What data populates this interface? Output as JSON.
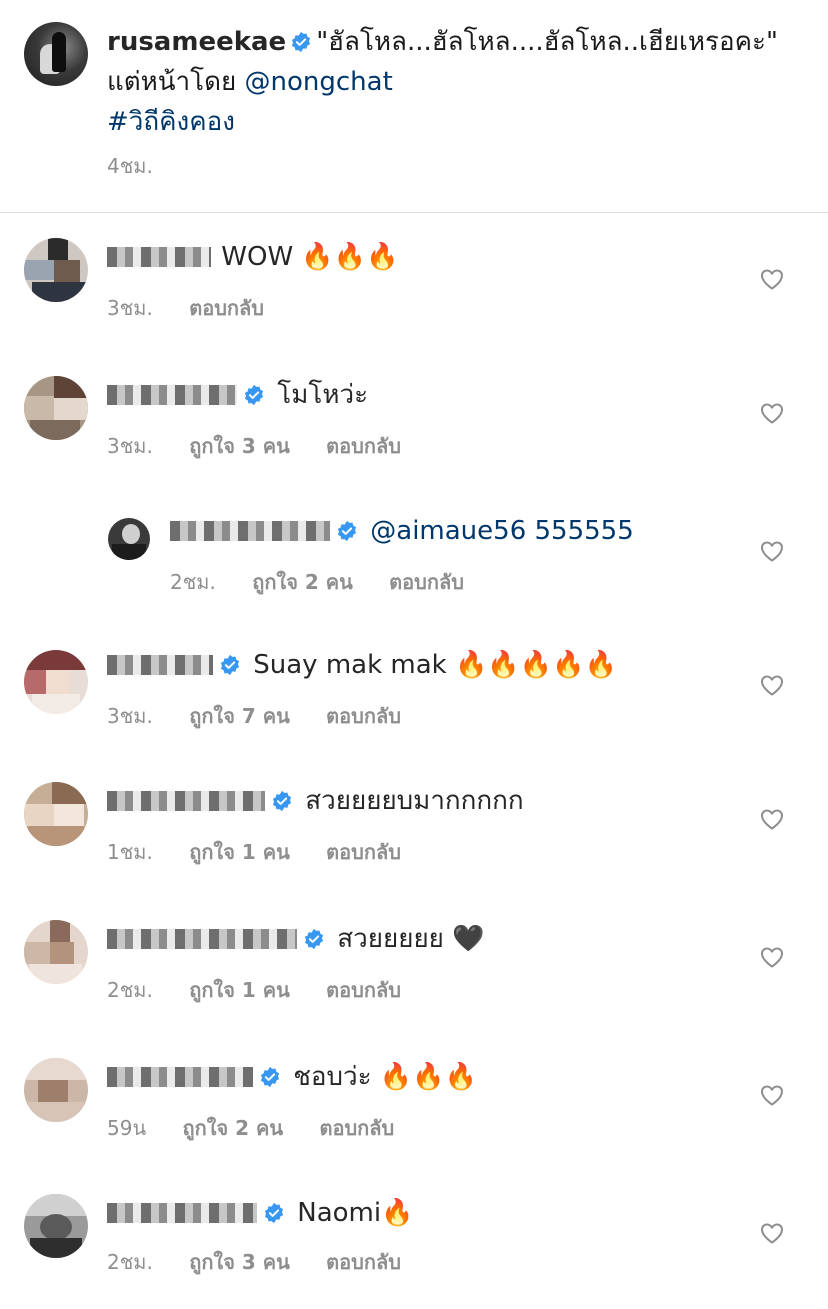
{
  "post": {
    "username": "rusameekae",
    "caption_line1": "\"ฮัลโหล...ฮัลโหล....ฮัลโหล..เฮียเหรอคะ\"",
    "caption_line2_prefix": "แต่หน้าโดย ",
    "mention": "@nongchat",
    "hashtag": "#วิถีคิงคอง",
    "time": "4ชม."
  },
  "comments": [
    {
      "username": "take...",
      "text": "WOW 🔥🔥🔥",
      "time": "3ชม.",
      "likes": "",
      "reply": "ตอบกลับ"
    },
    {
      "username": "aimaue56",
      "text": "โมโหว่ะ",
      "time": "3ชม.",
      "likes": "ถูกใจ 3 คน",
      "reply": "ตอบกลับ"
    },
    {
      "username": "r...",
      "text": "@aimaue56 555555",
      "time": "2ชม.",
      "likes": "ถูกใจ 2 คน",
      "reply": "ตอบกลับ"
    },
    {
      "username": "matinee",
      "text": "Suay mak mak 🔥🔥🔥🔥🔥",
      "time": "3ชม.",
      "likes": "ถูกใจ 7 คน",
      "reply": "ตอบกลับ"
    },
    {
      "username": "k...n",
      "text": "สวยยยยบมากกกกก",
      "time": "1ชม.",
      "likes": "ถูกใจ 1 คน",
      "reply": "ตอบกลับ"
    },
    {
      "username": "p...",
      "text": "สวยยยยย 🖤",
      "time": "2ชม.",
      "likes": "ถูกใจ 1 คน",
      "reply": "ตอบกลับ"
    },
    {
      "username": "...",
      "text": "ชอบว่ะ 🔥🔥🔥",
      "time": "59น",
      "likes": "ถูกใจ 2 คน",
      "reply": "ตอบกลับ"
    },
    {
      "username": "n_...m",
      "text": "Naomi🔥",
      "time": "2ชม.",
      "likes": "ถูกใจ 3 คน",
      "reply": "ตอบกลับ"
    }
  ],
  "colors": {
    "verified": "#3897f0",
    "link": "#00376b",
    "meta": "#8e8e8e"
  },
  "icons": {
    "verified": "verified-badge-icon",
    "like": "heart-outline-icon"
  }
}
